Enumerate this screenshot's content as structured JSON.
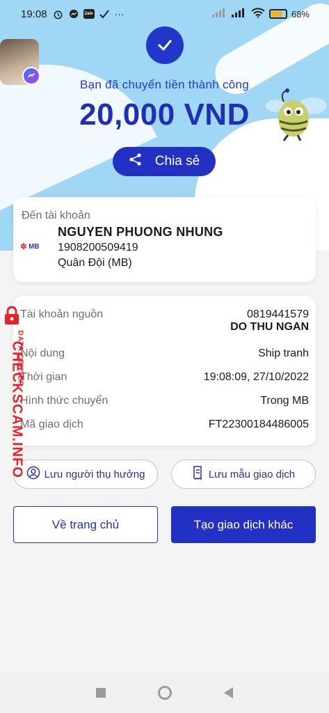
{
  "status_bar": {
    "time": "19:08",
    "battery_percent": "68%",
    "battery_level": 0.68,
    "notification_icons": [
      "alarm-icon",
      "messenger-icon",
      "zalo-icon",
      "checkmark-icon",
      "more-icon"
    ],
    "zalo_label": "Zalo"
  },
  "success": {
    "message": "Bạn đã chuyển tiền thành công",
    "amount": "20,000 VND",
    "share_label": "Chia sẻ"
  },
  "recipient": {
    "label": "Đến tài khoản",
    "name": "NGUYEN PHUONG NHUNG",
    "account_number": "1908200509419",
    "bank": "Quân Đội (MB)",
    "bank_logo_text": "MB"
  },
  "details": {
    "rows": [
      {
        "label": "Tài khoản nguồn",
        "value": "0819441579",
        "sub_value": "DO THU NGAN"
      },
      {
        "label": "Nội dung",
        "value": "Ship tranh"
      },
      {
        "label": "Thời gian",
        "value": "19:08:09, 27/10/2022"
      },
      {
        "label": "Hình thức chuyển",
        "value": "Trong MB"
      },
      {
        "label": "Mã giao dịch",
        "value": "FT22300184486005"
      }
    ]
  },
  "actions": {
    "save_beneficiary": "Lưu người thụ hưởng",
    "save_template": "Lưu mẫu giao dịch",
    "home": "Về trang chủ",
    "new_transaction": "Tạo giao dịch khác"
  },
  "watermark": {
    "brand": "CHECKSCAM.INFO",
    "sub": "DATA CENTER"
  },
  "colors": {
    "primary": "#2231c3",
    "hero_bg": "#9fd7f4",
    "watermark": "#e8222b"
  }
}
